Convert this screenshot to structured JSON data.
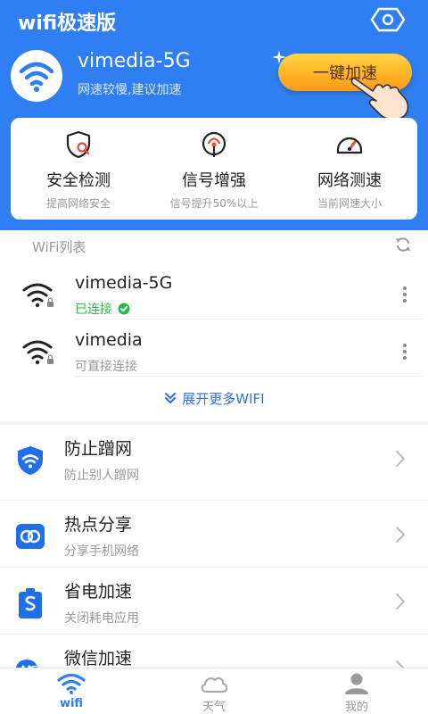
{
  "app": {
    "title": "wifi极速版"
  },
  "connection": {
    "ssid": "vimedia-5G",
    "status_text": "网速较慢,建议加速",
    "boost_label": "一键加速"
  },
  "features": [
    {
      "title": "安全检测",
      "subtitle": "提高网络安全",
      "icon": "shield-search-icon"
    },
    {
      "title": "信号增强",
      "subtitle": "信号提升50%以上",
      "icon": "signal-icon"
    },
    {
      "title": "网络测速",
      "subtitle": "当前网速大小",
      "icon": "speedometer-icon"
    }
  ],
  "wifi_list": {
    "title": "WiFi列表",
    "networks": [
      {
        "name": "vimedia-5G",
        "status": "已连接"
      },
      {
        "name": "vimedia",
        "status": "可直接连接"
      }
    ],
    "expand_label": "展开更多WIFI"
  },
  "tools": [
    {
      "title": "防止蹭网",
      "subtitle": "防止别人蹭网",
      "icon": "shield-wifi-icon"
    },
    {
      "title": "热点分享",
      "subtitle": "分享手机网络",
      "icon": "hotspot-share-icon"
    },
    {
      "title": "省电加速",
      "subtitle": "关闭耗电应用",
      "icon": "battery-save-icon"
    },
    {
      "title": "微信加速",
      "subtitle": "",
      "icon": "wechat-icon"
    }
  ],
  "nav": [
    {
      "label": "wifi",
      "icon": "wifi-icon",
      "active": true
    },
    {
      "label": "天气",
      "icon": "cloud-icon",
      "active": false
    },
    {
      "label": "我的",
      "icon": "user-icon",
      "active": false
    }
  ],
  "colors": {
    "primary": "#2f7ff2",
    "accent": "#ffb423",
    "success": "#2db84d"
  }
}
